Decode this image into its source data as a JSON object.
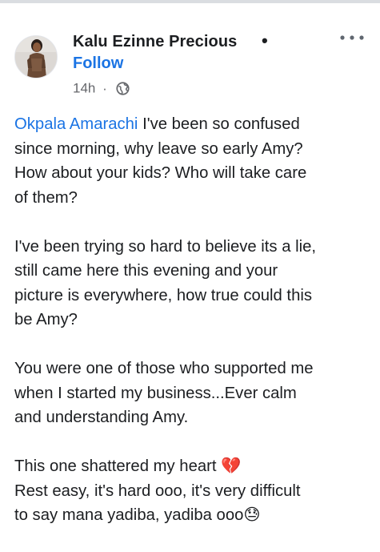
{
  "colors": {
    "link": "#1b74e4",
    "text": "#1c1e21",
    "muted": "#65676b"
  },
  "post": {
    "author_name": "Kalu Ezinne Precious",
    "separator": "•",
    "follow_label": "Follow",
    "time": "14h",
    "time_separator": "·",
    "privacy_icon": "globe-icon",
    "more_icon": "more-horizontal-icon",
    "mention": "Okpala Amarachi",
    "paragraphs": [
      {
        "lines": [
          " I've been so confused",
          "since morning, why leave so early Amy?",
          "How about your kids? Who will take care",
          "of them?"
        ]
      },
      {
        "lines": [
          "I've been trying so hard to believe its a lie,",
          "still came here this evening and your",
          "picture is everywhere, how true could this",
          "be Amy?"
        ]
      },
      {
        "lines": [
          "You were one of those who supported me",
          "when I started my business...Ever calm",
          "and understanding Amy."
        ]
      },
      {
        "lines": [
          "This one shattered my heart 💔",
          "Rest easy, it's hard ooo, it's very difficult",
          "to say mana yadiba, yadiba ooo😓"
        ]
      }
    ]
  }
}
